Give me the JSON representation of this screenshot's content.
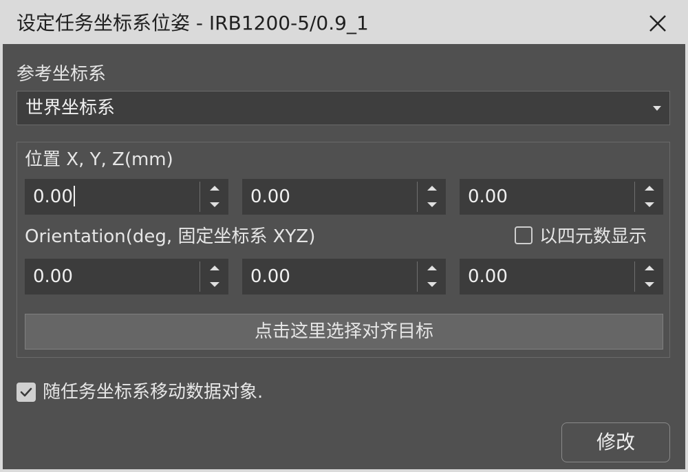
{
  "window": {
    "title": "设定任务坐标系位姿 - IRB1200-5/0.9_1"
  },
  "reference_frame": {
    "label": "参考坐标系",
    "selected": "世界坐标系"
  },
  "position": {
    "label": "位置 X, Y, Z(mm)",
    "x": "0.00",
    "y": "0.00",
    "z": "0.00"
  },
  "orientation": {
    "label": "Orientation(deg, 固定坐标系 XYZ)",
    "rx": "0.00",
    "ry": "0.00",
    "rz": "0.00",
    "quaternion_label": "以四元数显示",
    "quaternion_checked": false
  },
  "align_button": {
    "label": "点击这里选择对齐目标"
  },
  "follow": {
    "label": "随任务坐标系移动数据对象.",
    "checked": true
  },
  "modify_button": {
    "label": "修改"
  },
  "colors": {
    "titlebar": "#dadada",
    "client_bg": "#505050",
    "field_bg": "#3c3c3c",
    "text": "#e6e6e6"
  }
}
